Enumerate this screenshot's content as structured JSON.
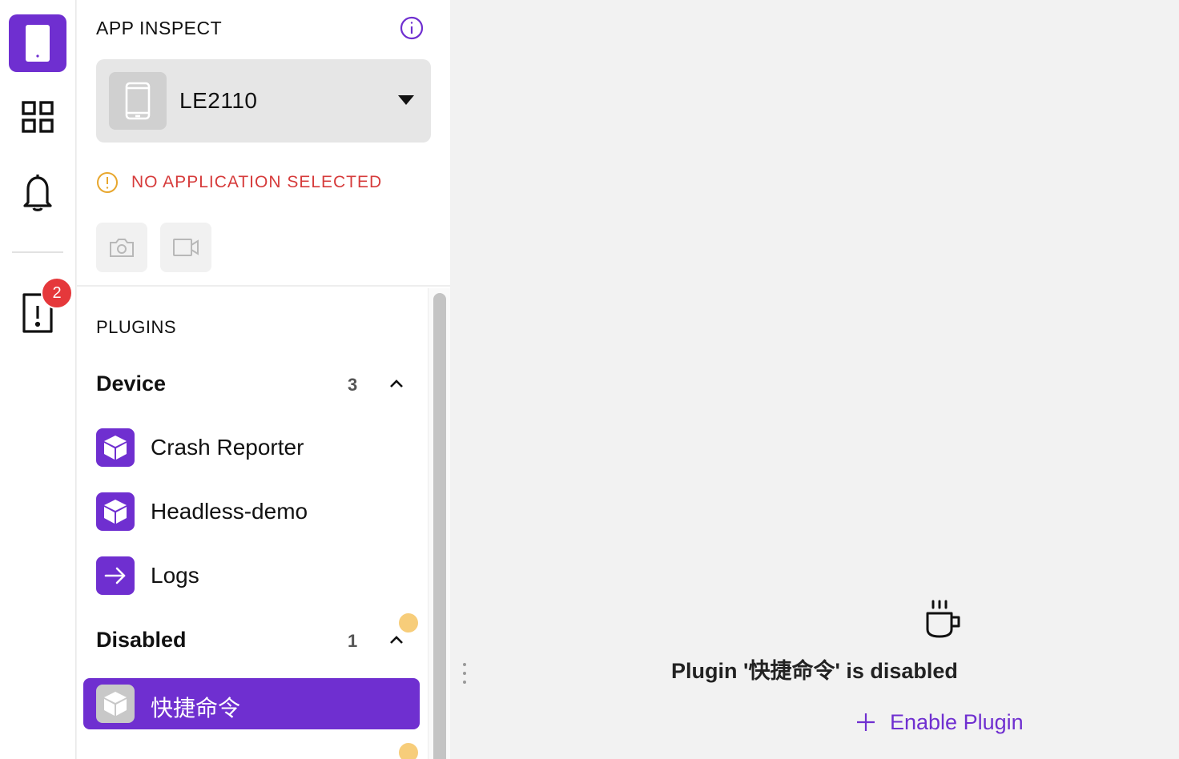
{
  "rail": {
    "items": [
      {
        "name": "device",
        "icon": "phone-icon"
      },
      {
        "name": "apps",
        "icon": "grid-icon"
      },
      {
        "name": "notifications",
        "icon": "bell-icon"
      },
      {
        "name": "alerts",
        "icon": "alert-doc-icon",
        "badge": "2"
      }
    ]
  },
  "sidebar": {
    "title": "APP INSPECT",
    "device": {
      "name": "LE2110"
    },
    "warning": "NO APPLICATION SELECTED",
    "tools": [
      {
        "icon": "camera-icon"
      },
      {
        "icon": "video-icon"
      }
    ],
    "plugins": {
      "title": "PLUGINS",
      "sections": [
        {
          "name": "Device",
          "count": "3",
          "items": [
            "Crash Reporter",
            "Headless-demo",
            "Logs"
          ]
        },
        {
          "name": "Disabled",
          "count": "1",
          "items": [
            "快捷命令"
          ]
        }
      ]
    }
  },
  "main": {
    "message": "Plugin '快捷命令' is disabled",
    "enable_label": "Enable Plugin"
  },
  "colors": {
    "accent": "#6f2fd0",
    "warning": "#d63b3b",
    "badge": "#e5383b",
    "dot": "#f7cd7a"
  }
}
